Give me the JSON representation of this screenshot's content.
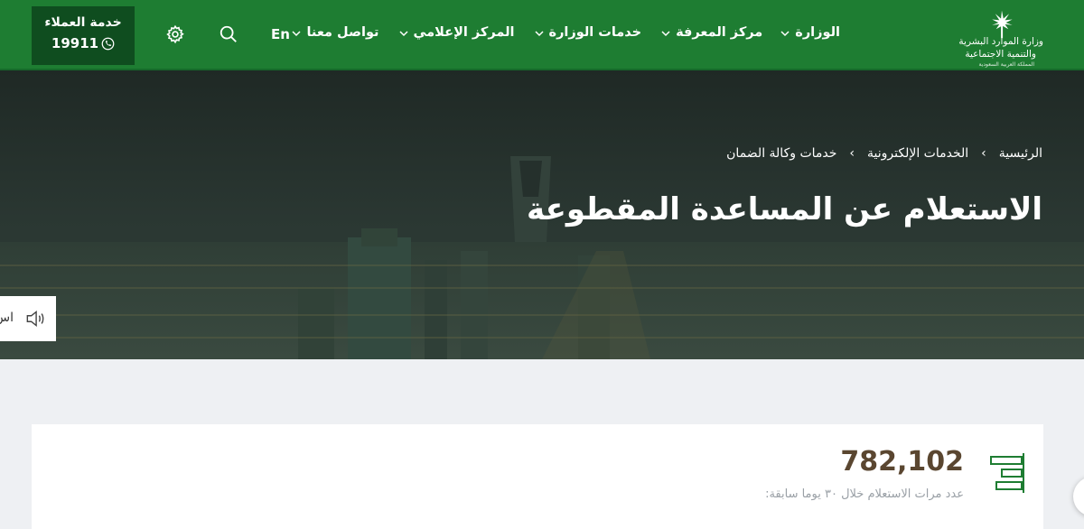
{
  "header": {
    "customer_service": {
      "title": "خدمة العملاء",
      "number": "19911"
    },
    "lang": "En",
    "nav": [
      "الوزارة",
      "مركز المعرفة",
      "خدمات الوزارة",
      "المركز الإعلامي",
      "تواصل معنا"
    ],
    "logo": {
      "line1": "وزارة الموارد البشرية",
      "line2": "والتنمية الاجتماعية",
      "line3": "المملكة العربية السعودية"
    }
  },
  "hero": {
    "breadcrumb": [
      "الرئيسية",
      "الخدمات الإلكترونية",
      "خدمات وكالة الضمان"
    ],
    "title": "الاستعلام عن المساعدة المقطوعة",
    "listen_label": "اس"
  },
  "stats": {
    "value": "782,102",
    "label": "عدد مرات الاستعلام خلال ٣٠ يوما سابقة:"
  },
  "colors": {
    "header_green": "#1e7d32",
    "customer_service_bg": "#0f4d1f",
    "stat_value": "#5a4630"
  }
}
